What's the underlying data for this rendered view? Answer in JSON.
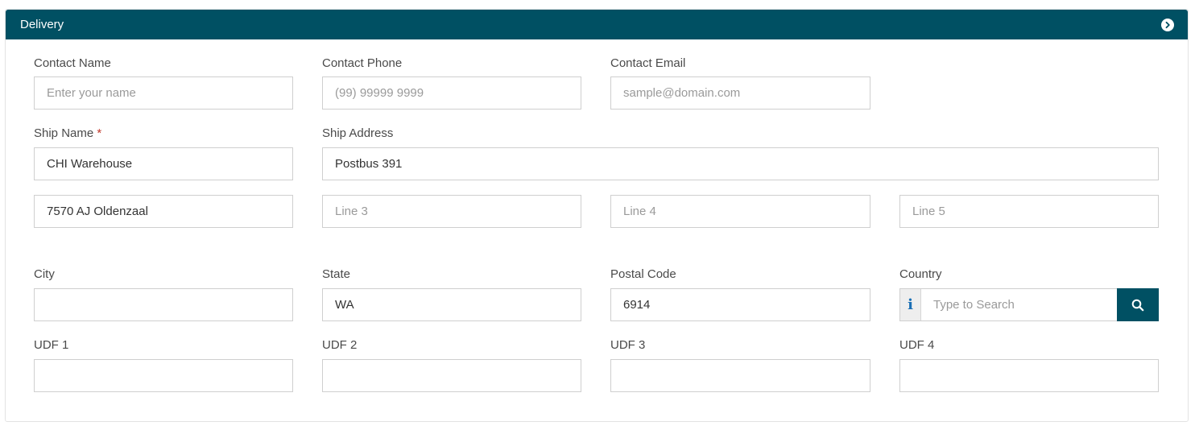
{
  "panel": {
    "title": "Delivery",
    "toggle_icon": "chevron-right-circle-icon"
  },
  "fields": {
    "contact_name": {
      "label": "Contact Name",
      "value": "",
      "placeholder": "Enter your name"
    },
    "contact_phone": {
      "label": "Contact Phone",
      "value": "",
      "placeholder": "(99) 99999 9999"
    },
    "contact_email": {
      "label": "Contact Email",
      "value": "",
      "placeholder": "sample@domain.com"
    },
    "ship_name": {
      "label": "Ship Name",
      "required_mark": "*",
      "value": "CHI Warehouse",
      "placeholder": ""
    },
    "ship_address": {
      "label": "Ship Address",
      "value": "Postbus 391",
      "placeholder": ""
    },
    "line2": {
      "value": "7570 AJ Oldenzaal",
      "placeholder": ""
    },
    "line3": {
      "value": "",
      "placeholder": "Line 3"
    },
    "line4": {
      "value": "",
      "placeholder": "Line 4"
    },
    "line5": {
      "value": "",
      "placeholder": "Line 5"
    },
    "city": {
      "label": "City",
      "value": "",
      "placeholder": ""
    },
    "state": {
      "label": "State",
      "value": "WA",
      "placeholder": ""
    },
    "postal_code": {
      "label": "Postal Code",
      "value": "6914",
      "placeholder": ""
    },
    "country": {
      "label": "Country",
      "value": "",
      "placeholder": "Type to Search",
      "info_glyph": "i",
      "search_icon": "search-icon"
    },
    "udf1": {
      "label": "UDF 1",
      "value": "",
      "placeholder": ""
    },
    "udf2": {
      "label": "UDF 2",
      "value": "",
      "placeholder": ""
    },
    "udf3": {
      "label": "UDF 3",
      "value": "",
      "placeholder": ""
    },
    "udf4": {
      "label": "UDF 4",
      "value": "",
      "placeholder": ""
    }
  },
  "colors": {
    "header_bg": "#005063",
    "required": "#c0392b",
    "info_icon": "#1a6fb5"
  }
}
